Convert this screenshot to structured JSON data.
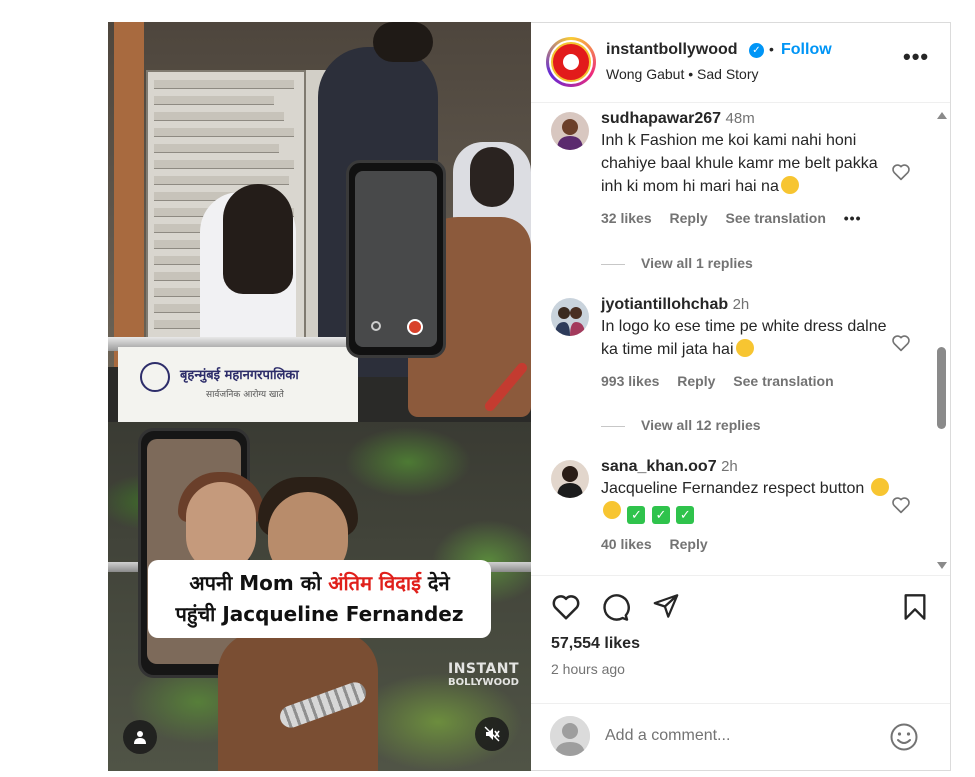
{
  "post": {
    "username": "instantbollywood",
    "separator": "•",
    "follow_label": "Follow",
    "audio": "Wong Gabut • Sad Story",
    "more_label": "•••"
  },
  "media": {
    "sign_title": "बृहन्मुंबई महानगरपालिका",
    "sign_subtitle": "सार्वजनिक आरोग्य खाते",
    "caption_line1_pre": "अपनी Mom को ",
    "caption_line1_red": "अंतिम विदाई",
    "caption_line1_post": " देने",
    "caption_line2": "पहुंची Jacqueline Fernandez",
    "watermark_line1": "INSTANT",
    "watermark_line2": "BOLLYWOOD",
    "accent_red": "#e0201b"
  },
  "comments": [
    {
      "username": "sudhapawar267",
      "time": "48m",
      "text": "Inh k Fashion me koi kami nahi honi chahiye baal khule kamr me belt pakka inh ki mom hi mari hai na",
      "likes": "32 likes",
      "reply": "Reply",
      "translate": "See translation",
      "more": "•••",
      "view_replies": "View all 1 replies"
    },
    {
      "username": "jyotiantillohchab",
      "time": "2h",
      "text": "In logo ko ese time pe white dress dalne ka time mil jata hai",
      "likes": "993 likes",
      "reply": "Reply",
      "translate": "See translation",
      "view_replies": "View all 12 replies"
    },
    {
      "username": "sana_khan.oo7",
      "time": "2h",
      "text": "Jacqueline Fernandez respect button",
      "likes": "40 likes",
      "reply": "Reply"
    }
  ],
  "footer": {
    "likes": "57,554 likes",
    "posted": "2 hours ago",
    "comment_placeholder": "Add a comment..."
  },
  "colors": {
    "link_blue": "#0095f6",
    "secondary_text": "#737373"
  },
  "icons": [
    "heart-icon",
    "comment-icon",
    "share-icon",
    "bookmark-icon",
    "emoji-icon",
    "mute-icon",
    "user-tag-icon",
    "verified-icon"
  ]
}
